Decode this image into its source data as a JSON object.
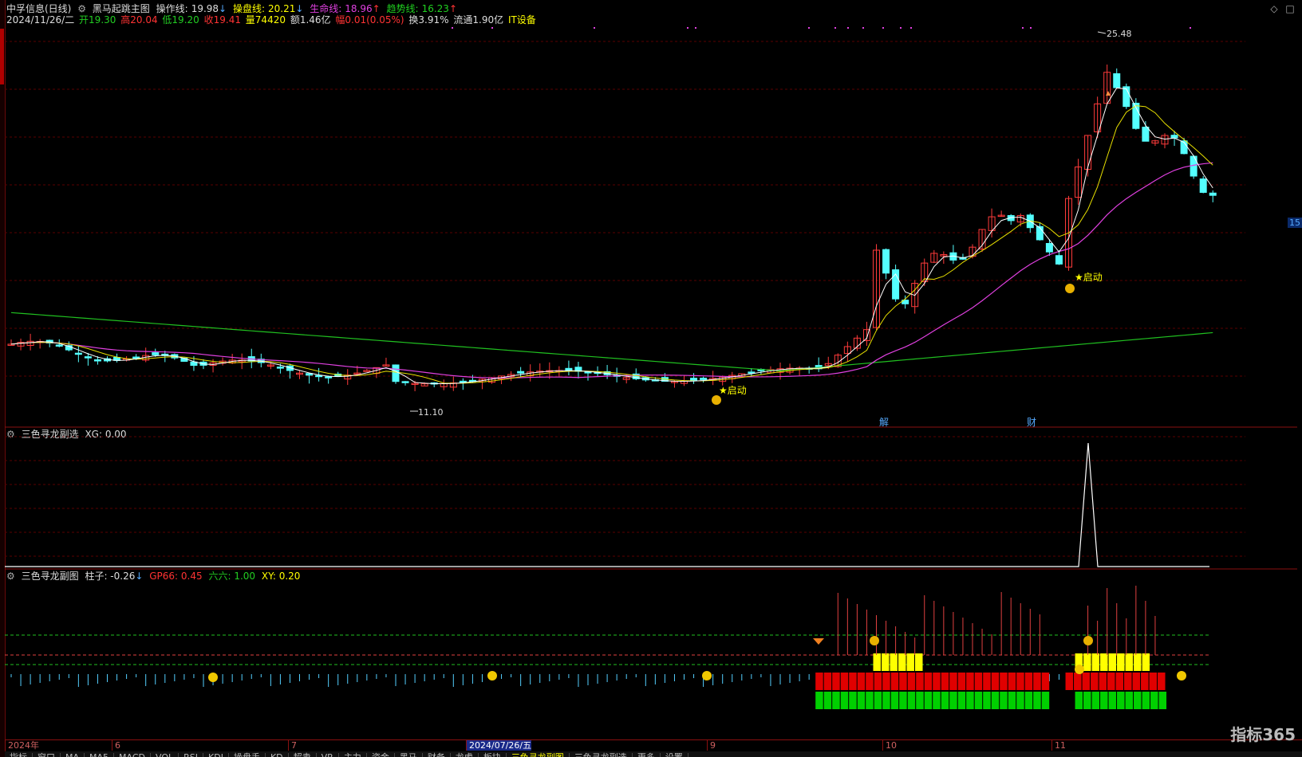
{
  "header": {
    "stock_name": "中孚信息(日线)",
    "indicator_name": "黑马起跳主图",
    "czx_label": "操作线:",
    "czx_value": "19.98",
    "cpx_label": "操盘线:",
    "cpx_value": "20.21",
    "smx_label": "生命线:",
    "smx_value": "18.96",
    "qsx_label": "趋势线:",
    "qsx_value": "16.23",
    "down_arrow": "↓",
    "up_arrow": "↑"
  },
  "quote": {
    "date": "2024/11/26/二",
    "open": "开19.30",
    "high": "高20.04",
    "low": "低19.20",
    "close": "收19.41",
    "volume": "量74420",
    "amount": "额1.46亿",
    "change": "幅0.01(0.05%)",
    "turnover": "换3.91%",
    "float": "流通1.90亿",
    "sector": "IT设备"
  },
  "main_chart": {
    "max_label": "25.48",
    "min_label": "11.10",
    "qidong_label": "★启动",
    "annot_jie": "解",
    "annot_cai": "财",
    "price_marker": "15"
  },
  "sub1": {
    "title": "三色寻龙副选",
    "xg_label": "XG: 0.00"
  },
  "sub2": {
    "title": "三色寻龙副图",
    "zhuzi": "柱子: -0.26",
    "gp66": "GP66: 0.45",
    "liuliu": "六六: 1.00",
    "xy": "XY: 0.20"
  },
  "time_axis": [
    "2024年",
    "6",
    "7",
    "2024/07/26/五",
    "9",
    "10",
    "11"
  ],
  "tabs": [
    "指标",
    "窗口",
    "MA",
    "MA5",
    "MACD",
    "VOL",
    "RSI",
    "KDJ",
    "操盘手",
    "KD",
    "超卖",
    "VR",
    "主力",
    "资金",
    "黑马",
    "财务",
    "龙虎",
    "板块",
    "三色寻龙副图",
    "三色寻龙副选",
    "更多",
    "设置"
  ],
  "logo": "指标365",
  "colors": {
    "up": "#ff3b3b",
    "down": "#54ffff",
    "grid": "#5a0000",
    "ma_white": "#ffffff",
    "ma_yellow": "#e8e000",
    "ma_magenta": "#e040e0",
    "ma_green": "#20c020"
  }
}
